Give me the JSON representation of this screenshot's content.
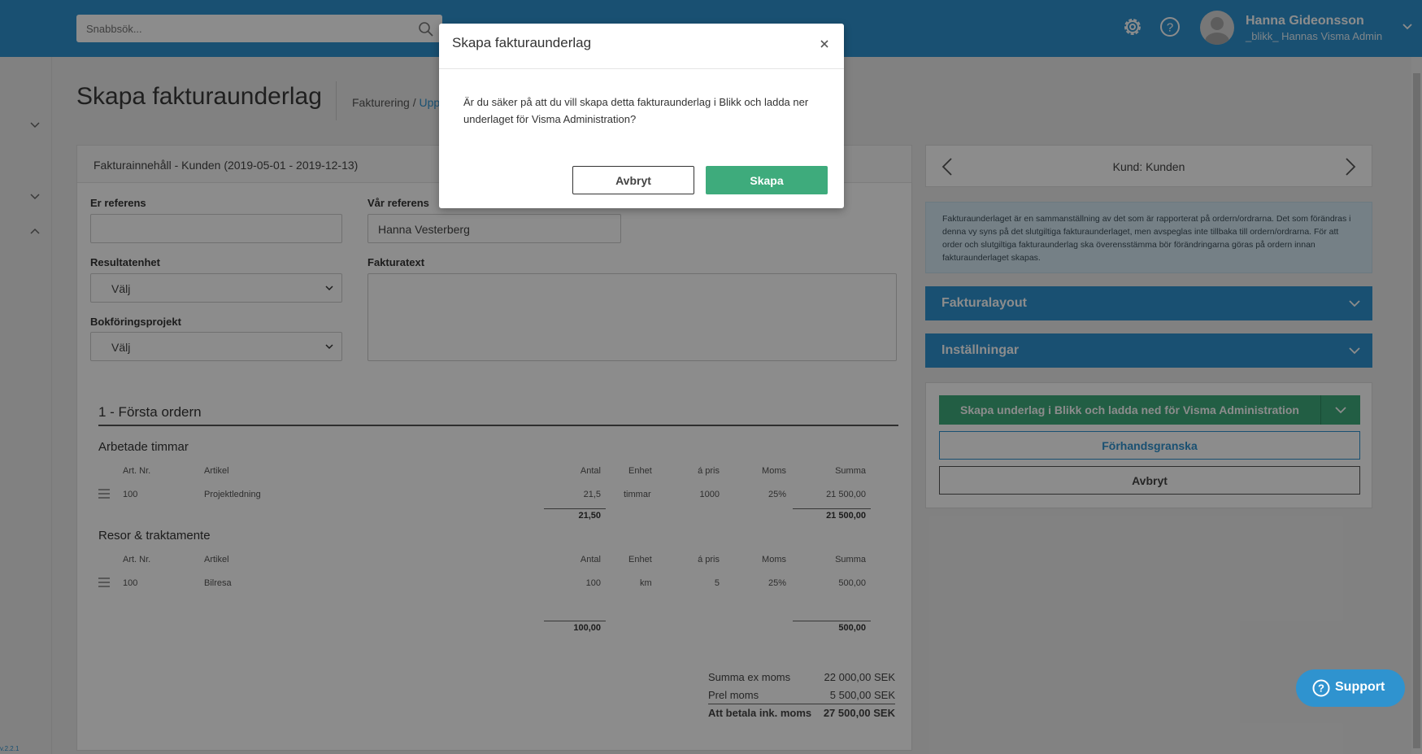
{
  "topbar": {
    "search_placeholder": "Snabbsök...",
    "user_name": "Hanna Gideonsson",
    "user_org": "_blikk_ Hannas Visma Admin"
  },
  "page": {
    "title": "Skapa fakturaunderlag",
    "breadcrumb_1": "Fakturering",
    "breadcrumb_sep": " / ",
    "breadcrumb_2": "Upp"
  },
  "form": {
    "card_title": "Fakturainnehåll - Kunden (2019-05-01 - 2019-12-13)",
    "er_referens_label": "Er referens",
    "er_referens_value": "",
    "var_referens_label": "Vår referens",
    "var_referens_value": "Hanna Vesterberg",
    "resultatenhet_label": "Resultatenhet",
    "resultatenhet_value": "Välj",
    "fakturatext_label": "Fakturatext",
    "fakturatext_value": "",
    "bokforingsprojekt_label": "Bokföringsprojekt",
    "bokforingsprojekt_value": "Välj"
  },
  "order": {
    "title": "1 - Första ordern",
    "columns": {
      "art_nr": "Art. Nr.",
      "artikel": "Artikel",
      "antal": "Antal",
      "enhet": "Enhet",
      "a_pris": "á pris",
      "moms": "Moms",
      "summa": "Summa"
    },
    "groups": [
      {
        "title": "Arbetade timmar",
        "row": {
          "art_nr": "100",
          "artikel": "Projektledning",
          "antal": "21,5",
          "enhet": "timmar",
          "a_pris": "1000",
          "moms": "25%",
          "summa": "21 500,00"
        },
        "total_antal": "21,50",
        "total_summa": "21 500,00"
      },
      {
        "title": "Resor & traktamente",
        "row": {
          "art_nr": "100",
          "artikel": "Bilresa",
          "antal": "100",
          "enhet": "km",
          "a_pris": "5",
          "moms": "25%",
          "summa": "500,00"
        },
        "total_antal": "100,00",
        "total_summa": "500,00"
      }
    ],
    "totals": {
      "ex_moms_label": "Summa ex moms",
      "ex_moms_value": "22 000,00 SEK",
      "moms_label": "Prel moms",
      "moms_value": "5 500,00 SEK",
      "att_betala_label": "Att betala ink. moms",
      "att_betala_value": "27 500,00 SEK"
    }
  },
  "sidebar": {
    "customer_nav": "Kund: Kunden",
    "info_text": "Fakturaunderlaget är en sammanställning av det som är rapporterat på ordern/ordrarna. Det som förändras i denna vy syns på det slutgiltiga fakturaunderlaget, men avspeglas inte tillbaka till ordern/ordrarna. För att order och slutgiltiga fakturaunderlag ska överensstämma bör förändringarna göras på ordern innan fakturaunderlaget skapas.",
    "accordion_1": "Fakturalayout",
    "accordion_2": "Inställningar",
    "primary_action": "Skapa underlag i Blikk och ladda ned för Visma Administration",
    "preview_action": "Förhandsgranska",
    "cancel_action": "Avbryt"
  },
  "support_label": "Support",
  "version": "v.2.2.1",
  "modal": {
    "title": "Skapa fakturaunderlag",
    "close": "×",
    "body": "Är du säker på att du vill skapa detta fakturaunderlag i Blikk och ladda ner underlaget för Visma Administration?",
    "cancel": "Avbryt",
    "confirm": "Skapa"
  },
  "colors": {
    "brand_blue": "#2f93cf",
    "success_green": "#3eab7c",
    "info_bg": "#d6eaf5"
  }
}
